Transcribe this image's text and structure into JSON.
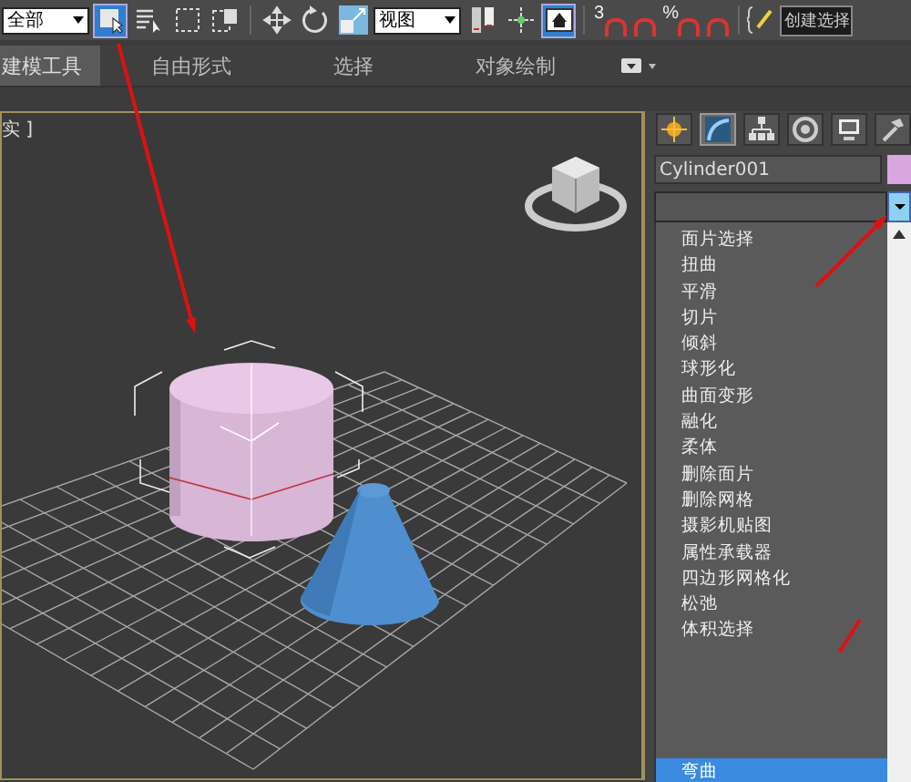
{
  "toolbar": {
    "filter_dropdown": "全部",
    "buttons": [
      {
        "kind": "select",
        "selected": true
      },
      {
        "kind": "select-by-name",
        "selected": false
      },
      {
        "kind": "rect-region",
        "selected": false
      },
      {
        "kind": "window-crossing",
        "selected": false
      },
      {
        "kind": "move",
        "selected": false
      },
      {
        "kind": "rotate",
        "selected": false
      },
      {
        "kind": "scale",
        "selected": false
      }
    ],
    "coordinate_dropdown": "视图",
    "buttons_2": [
      {
        "kind": "pivot",
        "selected": false
      },
      {
        "kind": "manipulate",
        "selected": false
      },
      {
        "kind": "keyboard",
        "selected": true
      }
    ],
    "snaps": [
      {
        "kind": "dimension",
        "label": "3"
      },
      {
        "kind": "angle"
      },
      {
        "kind": "percent",
        "label": "%"
      },
      {
        "kind": "spinner"
      }
    ],
    "selection_set_field": "创建选择"
  },
  "ribbon_tabs": [
    {
      "label": "建模工具",
      "selected": true
    },
    {
      "label": "自由形式",
      "selected": false
    },
    {
      "label": "选择",
      "selected": false
    },
    {
      "label": "对象绘制",
      "selected": false
    }
  ],
  "viewport": {
    "label": "实 ]"
  },
  "command_panel": {
    "tabs": [
      {
        "kind": "create",
        "selected": false
      },
      {
        "kind": "modify",
        "selected": true
      },
      {
        "kind": "hierarchy",
        "selected": false
      },
      {
        "kind": "motion",
        "selected": false
      },
      {
        "kind": "display",
        "selected": false
      },
      {
        "kind": "utilities",
        "selected": false
      }
    ],
    "object_name": "Cylinder001",
    "modifier_list": [
      {
        "label": "面片选择",
        "selected": false
      },
      {
        "label": "扭曲",
        "selected": false
      },
      {
        "label": "平滑",
        "selected": false
      },
      {
        "label": "切片",
        "selected": false
      },
      {
        "label": "倾斜",
        "selected": false
      },
      {
        "label": "球形化",
        "selected": false
      },
      {
        "label": "曲面变形",
        "selected": false
      },
      {
        "label": "融化",
        "selected": false
      },
      {
        "label": "柔体",
        "selected": false
      },
      {
        "label": "删除面片",
        "selected": false
      },
      {
        "label": "删除网格",
        "selected": false
      },
      {
        "label": "摄影机贴图",
        "selected": false
      },
      {
        "label": "属性承载器",
        "selected": false
      },
      {
        "label": "四边形网格化",
        "selected": false
      },
      {
        "label": "松弛",
        "selected": false
      },
      {
        "label": "体积选择",
        "selected": false
      },
      {
        "label": "弯曲",
        "selected": true
      }
    ]
  }
}
